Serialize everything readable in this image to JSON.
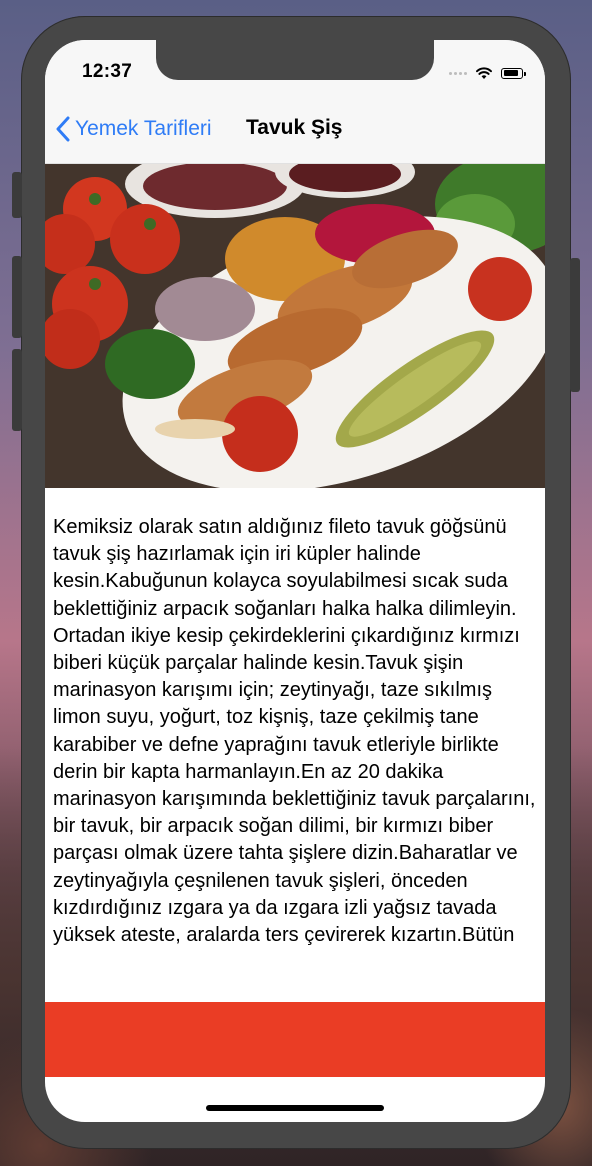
{
  "status_bar": {
    "time": "12:37"
  },
  "nav": {
    "back_label": "Yemek Tarifleri",
    "title": "Tavuk Şiş"
  },
  "recipe": {
    "image_alt": "Tavuk Şiş",
    "description": "Kemiksiz olarak satın aldığınız fileto tavuk göğsünü tavuk şiş hazırlamak için iri küpler halinde kesin.Kabuğunun kolayca soyulabilmesi sıcak suda beklettiğiniz arpacık soğanları halka halka dilimleyin. Ortadan ikiye kesip çekirdeklerini çıkardığınız kırmızı biberi küçük parçalar halinde kesin.Tavuk şişin marinasyon karışımı için; zeytinyağı, taze sıkılmış limon suyu, yoğurt, toz kişniş, taze çekilmiş tane karabiber ve defne yaprağını tavuk etleriyle birlikte derin bir kapta harmanlayın.En az 20 dakika marinasyon karışımında beklettiğiniz tavuk parçalarını, bir tavuk, bir arpacık soğan dilimi, bir kırmızı biber parçası olmak üzere tahta şişlere dizin.Baharatlar ve zeytinyağıyla çeşnilenen tavuk şişleri, önceden kızdırdığınız ızgara ya da ızgara izli yağsız tavada yüksek ateste, aralarda ters çevirerek kızartın.Bütün"
  },
  "colors": {
    "accent": "#2f7cf6",
    "footer": "#ea3d25"
  },
  "icons": {
    "back": "chevron-left-icon",
    "wifi": "wifi-icon",
    "battery": "battery-icon",
    "signal": "cellular-signal-icon"
  }
}
